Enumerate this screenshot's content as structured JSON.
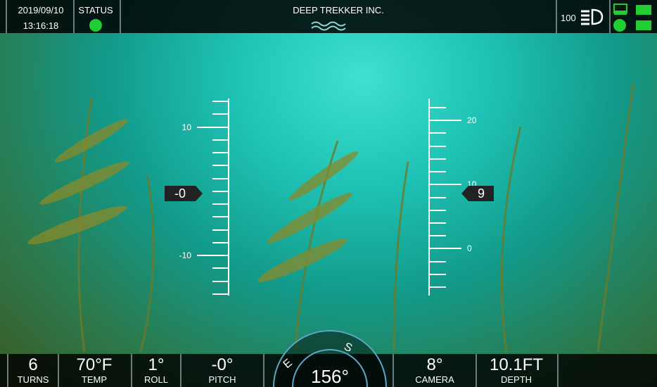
{
  "header": {
    "date": "2019/09/10",
    "time": "13:16:18",
    "status_label": "STATUS",
    "title": "DEEP TREKKER INC.",
    "light_level": "100"
  },
  "left_scale": {
    "labels": [
      "10",
      "-10"
    ],
    "marker_value": "-0"
  },
  "right_scale": {
    "labels": [
      "20",
      "10",
      "0"
    ],
    "marker_value": "9"
  },
  "telemetry": [
    {
      "value": "6",
      "label": "TURNS"
    },
    {
      "value": "70°F",
      "label": "TEMP"
    },
    {
      "value": "1°",
      "label": "ROLL"
    },
    {
      "value": "-0°",
      "label": "PITCH"
    },
    {
      "value": "8°",
      "label": "CAMERA"
    },
    {
      "value": "10.1FT",
      "label": "DEPTH"
    }
  ],
  "compass": {
    "heading": "156°",
    "letter_e": "E",
    "letter_s": "S"
  },
  "colors": {
    "status_green": "#22cc33",
    "bar_bg": "#000000",
    "marker_bg": "#222222"
  }
}
